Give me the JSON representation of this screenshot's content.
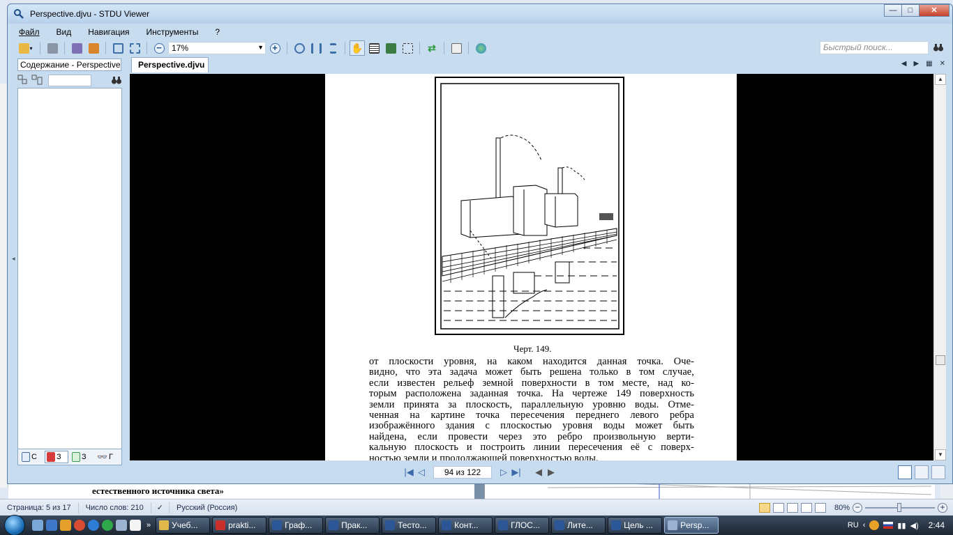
{
  "window": {
    "title": "Perspective.djvu - STDU Viewer",
    "controls": [
      "minimize",
      "maximize",
      "close"
    ]
  },
  "menu": [
    "Файл",
    "Вид",
    "Навигация",
    "Инструменты",
    "?"
  ],
  "toolbar": {
    "zoom_value": "17%",
    "search_placeholder": "Быстрый поиск..."
  },
  "sidebar": {
    "tab_label": "Содержание - Perspective.djvu",
    "bottom_tabs": [
      "С",
      "З",
      "З",
      "Г"
    ]
  },
  "document": {
    "tab_label": "Perspective.djvu",
    "caption": "Черт. 149.",
    "lines": [
      "от плоскости уровня, на каком находится данная точка. Оче-",
      "видно, что эта задача может быть решена только в том случае,",
      "если известен рельеф земной поверхности в том месте, над ко-",
      "торым расположена заданная точка. На чертеже 149 поверхность",
      "земли принята за плоскость, параллельную уровню воды. Отме-",
      "ченная на картине точка пересечения переднего левого ребра",
      "изображённого здания с плоскостью уровня воды может быть",
      "найдена, если провести через это ребро произвольную верти-",
      "кальную плоскость и построить линии пересечения её с поверх-",
      "ностью земли и продолжающей поверхностью воды."
    ]
  },
  "navigation": {
    "page_indicator": "94 из 122"
  },
  "background": {
    "doc_text": "естественного источника света»"
  },
  "word_status": {
    "page": "Страница: 5 из 17",
    "words": "Число слов: 210",
    "language": "Русский (Россия)",
    "zoom": "80%"
  },
  "taskbar": {
    "buttons": [
      "Учеб...",
      "prakti...",
      "Граф...",
      "Прак...",
      "Тесто...",
      "Конт...",
      "ГЛОС...",
      "Лите...",
      "Цель ...",
      "Persp..."
    ],
    "lang": "RU",
    "clock": "2:44"
  },
  "colors": {
    "accent": "#3a68a8",
    "window_frame": "#c8dcf0",
    "page_bg": "#ffffff",
    "viewer_bg": "#000000"
  }
}
